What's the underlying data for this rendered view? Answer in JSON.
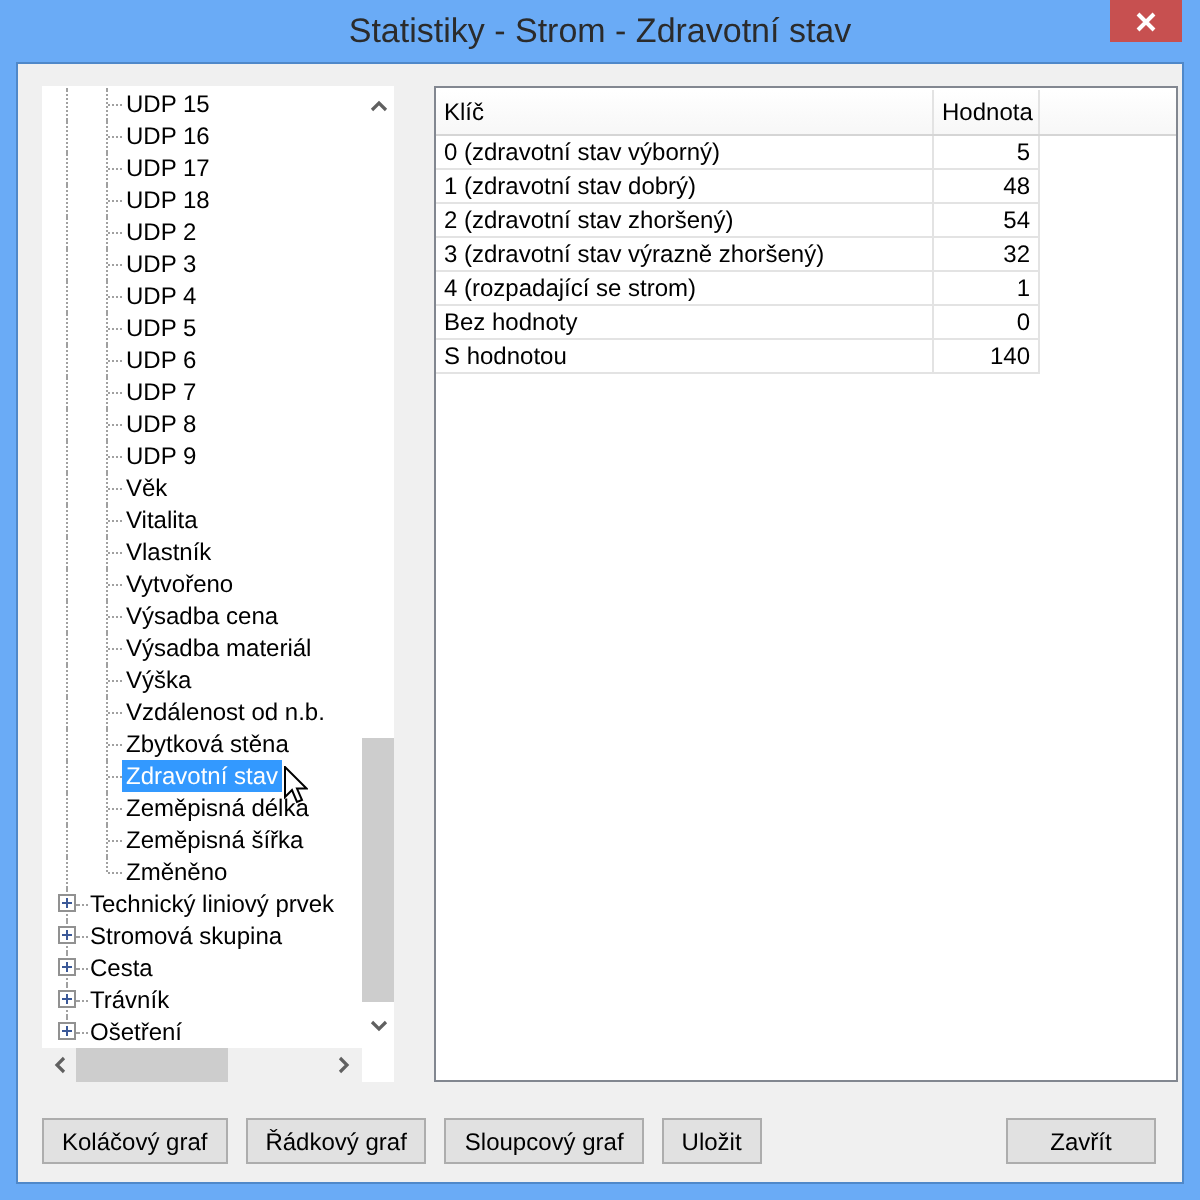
{
  "window": {
    "title": "Statistiky - Strom - Zdravotní stav"
  },
  "tree": {
    "items": [
      {
        "children": [
          {
            "label": "UDP 15",
            "selected": false
          },
          {
            "label": "UDP 16",
            "selected": false
          },
          {
            "label": "UDP 17",
            "selected": false
          },
          {
            "label": "UDP 18",
            "selected": false
          },
          {
            "label": "UDP 2",
            "selected": false
          },
          {
            "label": "UDP 3",
            "selected": false
          },
          {
            "label": "UDP 4",
            "selected": false
          },
          {
            "label": "UDP 5",
            "selected": false
          },
          {
            "label": "UDP 6",
            "selected": false
          },
          {
            "label": "UDP 7",
            "selected": false
          },
          {
            "label": "UDP 8",
            "selected": false
          },
          {
            "label": "UDP 9",
            "selected": false
          },
          {
            "label": "Věk",
            "selected": false
          },
          {
            "label": "Vitalita",
            "selected": false
          },
          {
            "label": "Vlastník",
            "selected": false
          },
          {
            "label": "Vytvořeno",
            "selected": false
          },
          {
            "label": "Výsadba cena",
            "selected": false
          },
          {
            "label": "Výsadba materiál",
            "selected": false
          },
          {
            "label": "Výška",
            "selected": false
          },
          {
            "label": "Vzdálenost od n.b.",
            "selected": false
          },
          {
            "label": "Zbytková stěna",
            "selected": false
          },
          {
            "label": "Zdravotní stav",
            "selected": true
          },
          {
            "label": "Zeměpisná délka",
            "selected": false
          },
          {
            "label": "Zeměpisná šířka",
            "selected": false
          },
          {
            "label": "Změněno",
            "selected": false
          }
        ]
      },
      {
        "label": "Technický liniový prvek",
        "expanded": false,
        "selected": false
      },
      {
        "label": "Stromová skupina",
        "expanded": false,
        "selected": false
      },
      {
        "label": "Cesta",
        "expanded": false,
        "selected": false
      },
      {
        "label": "Trávník",
        "expanded": false,
        "selected": false
      },
      {
        "label": "Ošetření",
        "expanded": false,
        "selected": false
      }
    ]
  },
  "table": {
    "columns": [
      "Klíč",
      "Hodnota"
    ],
    "rows": [
      [
        "0 (zdravotní stav výborný)",
        "5"
      ],
      [
        "1 (zdravotní stav dobrý)",
        "48"
      ],
      [
        "2 (zdravotní stav zhoršený)",
        "54"
      ],
      [
        "3 (zdravotní stav výrazně zhoršený)",
        "32"
      ],
      [
        "4 (rozpadající se strom)",
        "1"
      ],
      [
        "Bez hodnoty",
        "0"
      ],
      [
        "S hodnotou",
        "140"
      ]
    ]
  },
  "buttons": [
    "Koláčový graf",
    "Řádkový graf",
    "Sloupcový graf",
    "Uložit"
  ],
  "dismiss_button": "Zavřít"
}
